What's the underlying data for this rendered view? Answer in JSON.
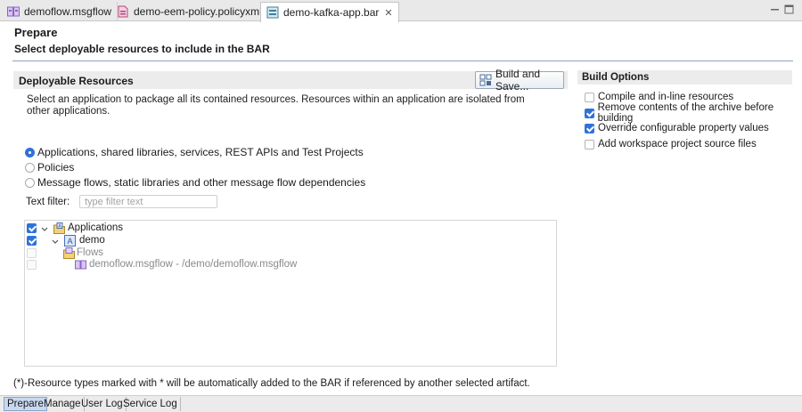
{
  "tabs": [
    {
      "label": "demoflow.msgflow",
      "icon": "msgflow-icon",
      "active": false
    },
    {
      "label": "demo-eem-policy.policyxml",
      "icon": "policy-icon",
      "active": false
    },
    {
      "label": "demo-kafka-app.bar",
      "icon": "bar-file-icon",
      "active": true,
      "close": "✕"
    }
  ],
  "header": {
    "title": "Prepare",
    "subtitle": "Select deployable resources to include in the BAR"
  },
  "deployable": {
    "heading": "Deployable Resources",
    "build_button": "Build and Save...",
    "description": "Select an application to package all its contained resources. Resources within an application are isolated from other applications.",
    "radios": [
      {
        "label": "Applications, shared libraries, services, REST APIs and Test Projects",
        "selected": true
      },
      {
        "label": "Policies",
        "selected": false
      },
      {
        "label": "Message flows, static libraries and other message flow dependencies",
        "selected": false
      }
    ],
    "filter_label": "Text filter:",
    "filter_placeholder": "type filter text",
    "tree": [
      {
        "label": "Applications",
        "checked": true,
        "expanded": true,
        "icon": "applications-folder-icon",
        "enabled": true
      },
      {
        "label": "demo",
        "checked": true,
        "expanded": true,
        "icon": "application-icon",
        "enabled": true
      },
      {
        "label": "Flows",
        "checked": false,
        "icon": "flows-folder-icon",
        "enabled": false
      },
      {
        "label": "demoflow.msgflow - /demo/demoflow.msgflow",
        "checked": false,
        "icon": "msgflow-icon",
        "enabled": false
      }
    ],
    "footnote": "(*)-Resource types marked with * will be automatically added to the BAR if referenced by another selected artifact."
  },
  "build_options": {
    "heading": "Build Options",
    "options": [
      {
        "label": "Compile and in-line resources",
        "checked": false
      },
      {
        "label": "Remove contents of the archive before building",
        "checked": true
      },
      {
        "label": "Override configurable property values",
        "checked": true
      },
      {
        "label": "Add workspace project source files",
        "checked": false
      }
    ]
  },
  "bottom_tabs": [
    {
      "label": "Prepare",
      "active": true
    },
    {
      "label": "Manage",
      "active": false
    },
    {
      "label": "User Log",
      "active": false
    },
    {
      "label": "Service Log",
      "active": false
    }
  ],
  "colors": {
    "accent": "#2f72d8",
    "separator": "#8ba3c4",
    "active_bottom_tab": "#c8d8ef"
  }
}
